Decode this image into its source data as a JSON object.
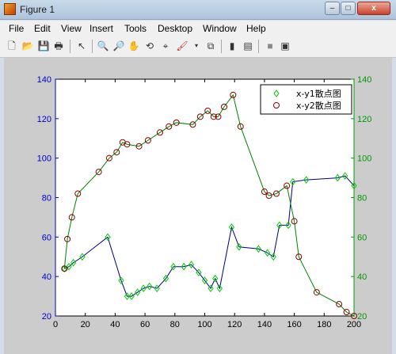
{
  "window": {
    "title": "Figure 1",
    "buttons": {
      "minimize": "–",
      "maximize": "□",
      "close": "x"
    }
  },
  "menubar": {
    "items": [
      "File",
      "Edit",
      "View",
      "Insert",
      "Tools",
      "Desktop",
      "Window",
      "Help"
    ]
  },
  "toolbar": {
    "icons": [
      "new-figure-icon",
      "open-file-icon",
      "save-icon",
      "print-icon",
      "pointer-icon",
      "zoom-in-icon",
      "zoom-out-icon",
      "pan-hand-icon",
      "rotate-3d-icon",
      "data-cursor-icon",
      "brush-icon",
      "dropdown-arrow-icon",
      "link-plot-icon",
      "colorbar-icon",
      "legend-icon",
      "hide-plot-tools-icon",
      "show-plot-tools-icon"
    ]
  },
  "colors": {
    "left_axis": "#0000cc",
    "right_axis": "#009900",
    "series1_marker": "#00cc00",
    "series2_marker": "#880000",
    "series1_line": "#000080",
    "series2_line": "#008000"
  },
  "chart_data": {
    "type": "scatter",
    "title": "",
    "x_ticks": [
      0,
      20,
      40,
      60,
      80,
      100,
      120,
      140,
      160,
      180,
      200
    ],
    "y_left_ticks": [
      20,
      40,
      60,
      80,
      100,
      120,
      140
    ],
    "y_right_ticks": [
      20,
      40,
      60,
      80,
      100,
      120,
      140
    ],
    "xlim": [
      0,
      200
    ],
    "ylim_left": [
      20,
      140
    ],
    "ylim_right": [
      20,
      140
    ],
    "legend_position": "top-right",
    "series": [
      {
        "name": "x-y1散点图",
        "marker": "diamond",
        "x": [
          6,
          9,
          12,
          18,
          35,
          44,
          48,
          51,
          55,
          59,
          63,
          68,
          74,
          79,
          86,
          91,
          96,
          100,
          104,
          107,
          110,
          118,
          123,
          136,
          142,
          146,
          150,
          156,
          159,
          168,
          189,
          194,
          200
        ],
        "y": [
          44,
          45,
          47,
          50,
          60,
          38,
          30,
          30,
          32,
          34,
          35,
          34,
          39,
          45,
          45,
          46,
          42,
          38,
          34,
          39,
          34,
          65,
          55,
          54,
          52,
          50,
          66,
          66,
          88,
          89,
          90,
          91,
          86
        ]
      },
      {
        "name": "x-y2散点图",
        "marker": "circle",
        "x": [
          6,
          8,
          11,
          15,
          29,
          36,
          41,
          45,
          48,
          56,
          62,
          70,
          76,
          81,
          92,
          97,
          102,
          106,
          109,
          113,
          119,
          124,
          140,
          143,
          148,
          155,
          160,
          163,
          175,
          190,
          195,
          200
        ],
        "y": [
          44,
          59,
          70,
          82,
          93,
          100,
          103,
          108,
          107,
          106,
          109,
          113,
          116,
          118,
          117,
          121,
          124,
          121,
          121,
          126,
          132,
          116,
          83,
          81,
          82,
          86,
          68,
          50,
          32,
          26,
          22,
          20
        ]
      }
    ]
  }
}
